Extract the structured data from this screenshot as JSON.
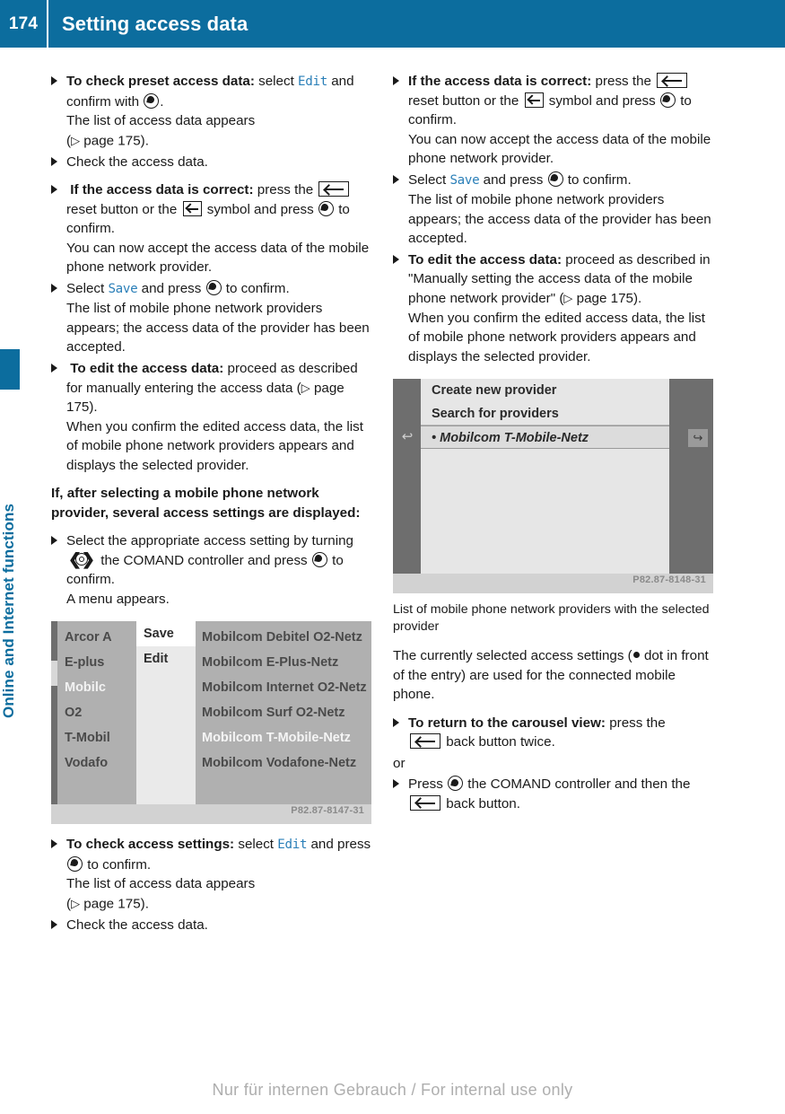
{
  "header": {
    "page_number": "174",
    "title": "Setting access data"
  },
  "sidebar": {
    "chapter_label": "Online and Internet functions"
  },
  "footer": {
    "text": "Nur für internen Gebrauch / For internal use only"
  },
  "colors": {
    "brand_blue": "#0c6d9e",
    "ui_term_blue": "#2a7fb8",
    "body_text": "#1a1a1a"
  },
  "left_column": {
    "b1": {
      "lead": "To check preset access data:",
      "t1": " select ",
      "term": "Edit",
      "t2": " and confirm with ",
      "t3": ".",
      "l2": "The list of access data appears",
      "l3_open": "(",
      "l3_ref": "page 175",
      "l3_close": ")."
    },
    "b2": {
      "text": "Check the access data."
    },
    "b3": {
      "lead": "If the access data is correct:",
      "t1": " press the ",
      "t2": " reset button or the ",
      "t3": " symbol and press ",
      "t4": " to confirm.",
      "l2": "You can now accept the access data of the mobile phone network provider."
    },
    "b4": {
      "t1": "Select ",
      "term": "Save",
      "t2": " and press ",
      "t3": " to confirm.",
      "l2": "The list of mobile phone network providers appears; the access data of the provider has been accepted."
    },
    "b5": {
      "lead": "To edit the access data:",
      "t1": " proceed as described for manually entering the access data (",
      "ref": "page 175",
      "t2": ").",
      "l2": "When you confirm the edited access data, the list of mobile phone network providers appears and displays the selected provider."
    },
    "heading": "If, after selecting a mobile phone network provider, several access settings are displayed:",
    "b6": {
      "t1": "Select the appropriate access setting by turning ",
      "t2": " the COMAND controller and press ",
      "t3": " to confirm.",
      "l2": "A menu appears."
    },
    "b7": {
      "lead": "To check access settings:",
      "t1": " select ",
      "term": "Edit",
      "t2": " and press ",
      "t3": " to confirm.",
      "l2": "The list of access data appears",
      "l3_open": "(",
      "l3_ref": "page 175",
      "l3_close": ")."
    },
    "b8": {
      "text": "Check the access data."
    }
  },
  "right_column": {
    "b1": {
      "lead": "If the access data is correct:",
      "t1": " press the ",
      "t2": " reset button or the ",
      "t3": " symbol and press ",
      "t4": " to confirm.",
      "l2": "You can now accept the access data of the mobile phone network provider."
    },
    "b2": {
      "t1": "Select ",
      "term": "Save",
      "t2": " and press ",
      "t3": " to confirm.",
      "l2": "The list of mobile phone network providers appears; the access data of the provider has been accepted."
    },
    "b3": {
      "lead": "To edit the access data:",
      "t1": " proceed as described in \"Manually setting the access data of the mobile phone network provider\" (",
      "ref": "page 175",
      "t2": ").",
      "l2": "When you confirm the edited access data, the list of mobile phone network providers appears and displays the selected provider."
    },
    "fig2_caption": "List of mobile phone network providers with the selected provider",
    "para1": {
      "t1": "The currently selected access settings (",
      "t2": " dot in front of the entry) are used for the connected mobile phone."
    },
    "b4": {
      "lead": "To return to the carousel view:",
      "t1": " press the ",
      "t2": " back button twice."
    },
    "or_label": "or",
    "b5": {
      "t1": "Press ",
      "t2": " the COMAND controller and then the ",
      "t3": " back button."
    }
  },
  "figure1": {
    "watermark": "P82.87-8147-31",
    "providers": [
      "Arcor A",
      "E-plus",
      "Mobilc",
      "O2",
      "T-Mobil",
      "Vodafo"
    ],
    "selected_provider_index": 2,
    "menu": [
      "Save",
      "Edit"
    ],
    "menu_highlight_index": 0,
    "netz_list": [
      "Mobilcom Debitel O2-Netz",
      "Mobilcom E-Plus-Netz",
      "Mobilcom Internet O2-Netz",
      "Mobilcom Surf O2-Netz",
      "Mobilcom T-Mobile-Netz",
      "Mobilcom Vodafone-Netz"
    ],
    "netz_selected_index": 4
  },
  "figure2": {
    "watermark": "P82.87-8148-31",
    "rows": [
      "Create new provider",
      "Search for providers"
    ],
    "highlight_row": "Mobilcom T-Mobile-Netz",
    "highlight_dot": "•",
    "icon_left": "↩",
    "icon_right": "↪"
  }
}
